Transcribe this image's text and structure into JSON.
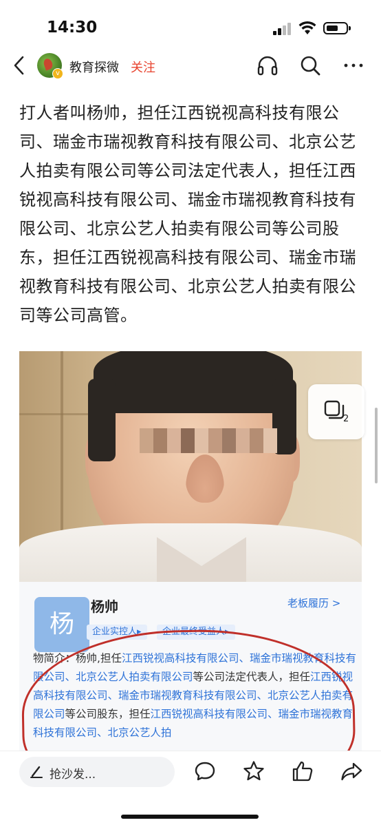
{
  "status_bar": {
    "time": "14:30"
  },
  "nav": {
    "author_name": "教育探微",
    "follow_label": "关注",
    "icons": [
      "back-icon",
      "headphones-icon",
      "search-icon",
      "more-icon"
    ]
  },
  "article": {
    "text": "打人者叫杨帅，担任江西锐视高科技有限公司、瑞金市瑞视教育科技有限公司、北京公艺人拍卖有限公司等公司法定代表人，担任江西锐视高科技有限公司、瑞金市瑞视教育科技有限公司、北京公艺人拍卖有限公司等公司股东，担任江西锐视高科技有限公司、瑞金市瑞视教育科技有限公司、北京公艺人拍卖有限公司等公司高管。"
  },
  "gallery": {
    "count": "2",
    "icon": "gallery-icon"
  },
  "card": {
    "avatar_char": "杨",
    "name": "杨帅",
    "tag_1": "企业实控人▸",
    "tag_2": "企业最终受益人▸",
    "link": "老板履历 >",
    "bio_label": "物简介：",
    "bio_1": "杨帅,担任",
    "bio_2": "江西锐视高科技有限公司、瑞金市瑞视",
    "bio_3": "教育科技有限公司、北京公艺人拍卖有限公司",
    "bio_4": "等公司法定代表",
    "bio_5": "人，担任",
    "bio_6": "江西锐视高科技有限公司、瑞金市瑞视教育科技有限",
    "bio_7": "公司、北京公艺人拍卖有限公司",
    "bio_8": "等公司股东，担任",
    "bio_9": "江西锐视高",
    "bio_10": "科技有限公司、瑞金市瑞视教育科技有限公司、北京公艺人拍"
  },
  "bottom_bar": {
    "comment_placeholder": "抢沙发...",
    "icons": [
      "comment-icon",
      "star-icon",
      "like-icon",
      "share-icon"
    ]
  },
  "colors": {
    "accent_red": "#e8432e",
    "link_blue": "#2f73d8"
  }
}
